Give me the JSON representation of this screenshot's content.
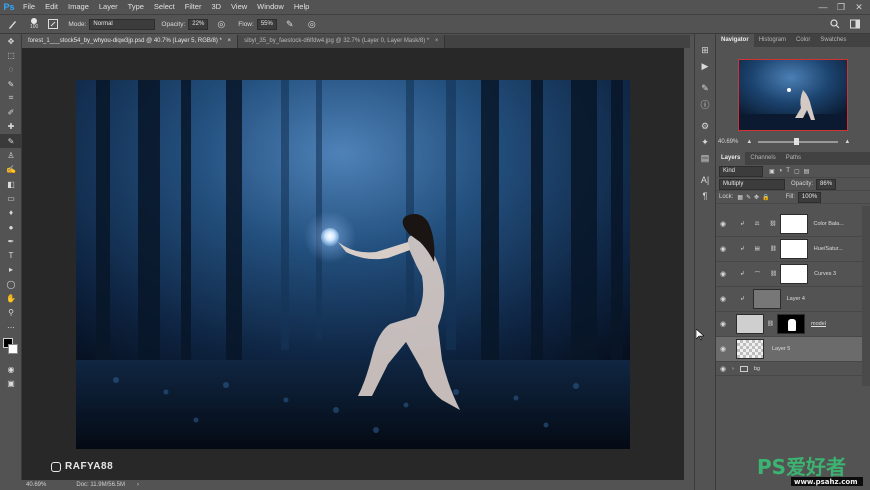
{
  "app": {
    "logo": "Ps",
    "accent": "#31a8ff"
  },
  "menu": [
    "File",
    "Edit",
    "Image",
    "Layer",
    "Type",
    "Select",
    "Filter",
    "3D",
    "View",
    "Window",
    "Help"
  ],
  "window_controls": [
    "—",
    "❐",
    "✕"
  ],
  "options": {
    "brush_size": "100",
    "mode_label": "Mode:",
    "mode_value": "Normal",
    "opacity_label": "Opacity:",
    "opacity_value": "22%",
    "flow_label": "Flow:",
    "flow_value": "55%"
  },
  "tabs": [
    {
      "label": "forest_1___stock54_by_whyou-diqw3jp.psd @ 40.7% (Layer 5, RGB/8) *",
      "close": "×",
      "active": true
    },
    {
      "label": "sibyl_35_by_faestock-d6lfdw4.jpg @ 32.7% (Layer 0, Layer Mask/8) *",
      "close": "×",
      "active": false
    }
  ],
  "status": {
    "zoom": "40.69%",
    "doc": "Doc: 11.9M/56.5M"
  },
  "watermark": {
    "handle": "RAFYA88"
  },
  "navigator_tabs": [
    "Navigator",
    "Histogram",
    "Color",
    "Swatches"
  ],
  "navigator": {
    "zoom": "40.69%"
  },
  "layers_tabs": [
    "Layers",
    "Channels",
    "Paths"
  ],
  "layers_panel": {
    "kind_label": "Kind",
    "blend_mode": "Multiply",
    "opacity_label": "Opacity:",
    "opacity_value": "86%",
    "lock_label": "Lock:",
    "fill_label": "Fill:",
    "fill_value": "100%"
  },
  "layers": [
    {
      "name": "Color Bala...",
      "type": "adjustment"
    },
    {
      "name": "Hue/Satur...",
      "type": "adjustment"
    },
    {
      "name": "Curves 3",
      "type": "adjustment"
    },
    {
      "name": "Layer 4",
      "type": "pixel"
    },
    {
      "name": "model",
      "type": "masked"
    },
    {
      "name": "Layer 5",
      "type": "selected"
    },
    {
      "name": "bg",
      "type": "group"
    }
  ],
  "brand_watermark": {
    "text": "PS爱好者",
    "url": "www.psahz.com"
  }
}
